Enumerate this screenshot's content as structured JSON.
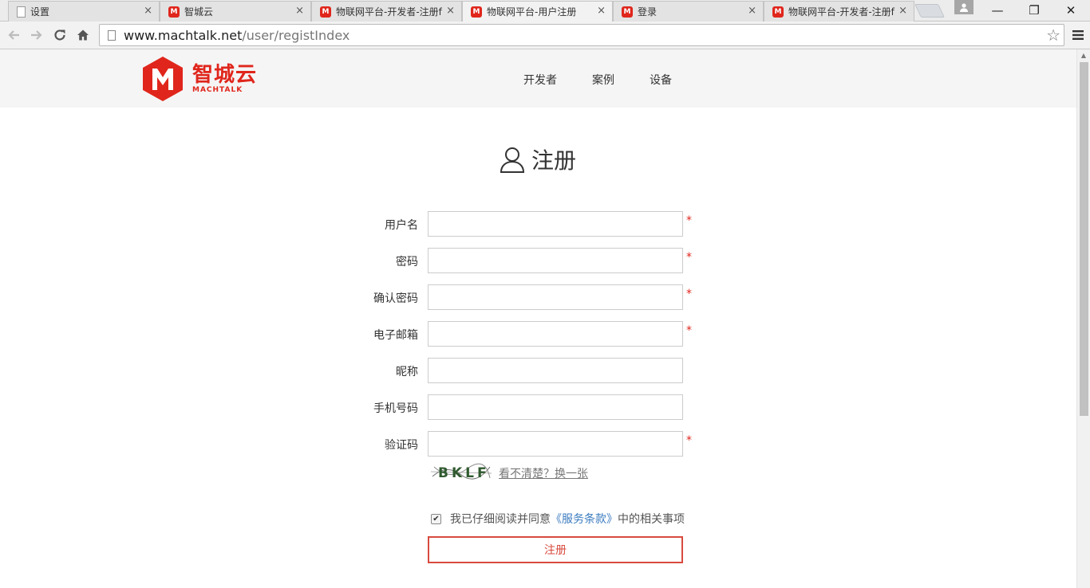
{
  "browser": {
    "tabs": [
      {
        "title": "设置",
        "icon": "page-icon",
        "close": "×"
      },
      {
        "title": "智城云",
        "icon": "machtalk-favicon",
        "close": "×"
      },
      {
        "title": "物联网平台-开发者-注册f",
        "icon": "machtalk-favicon",
        "close": "×"
      },
      {
        "title": "物联网平台-用户注册",
        "icon": "machtalk-favicon",
        "close": "×",
        "active": true
      },
      {
        "title": "登录",
        "icon": "machtalk-favicon",
        "close": "×"
      },
      {
        "title": "物联网平台-开发者-注册f",
        "icon": "machtalk-favicon",
        "close": "×"
      }
    ],
    "window_controls": {
      "minimize": "—",
      "restore": "❐",
      "close": "✕"
    },
    "url_host": "www.machtalk.net",
    "url_path": "/user/registIndex"
  },
  "site": {
    "logo_cn": "智城云",
    "logo_en": "MACHTALK",
    "nav": [
      "开发者",
      "案例",
      "设备"
    ]
  },
  "form": {
    "title": "注册",
    "fields": [
      {
        "label": "用户名",
        "value": "",
        "required": true
      },
      {
        "label": "密码",
        "value": "",
        "required": true
      },
      {
        "label": "确认密码",
        "value": "",
        "required": true
      },
      {
        "label": "电子邮箱",
        "value": "",
        "required": true
      },
      {
        "label": "昵称",
        "value": "",
        "required": false
      },
      {
        "label": "手机号码",
        "value": "",
        "required": false
      },
      {
        "label": "验证码",
        "value": "",
        "required": true
      }
    ],
    "required_mark": "*",
    "captcha_text": "BKLF",
    "captcha_refresh": "看不清楚？换一张",
    "agree_prefix": "我已仔细阅读并同意",
    "agree_terms": "《服务条款》",
    "agree_suffix": "中的相关事项",
    "agree_checked": true,
    "submit_label": "注册"
  },
  "colors": {
    "brand": "#e0261c",
    "link": "#3a7bbf",
    "button_border": "#d74a3e"
  }
}
